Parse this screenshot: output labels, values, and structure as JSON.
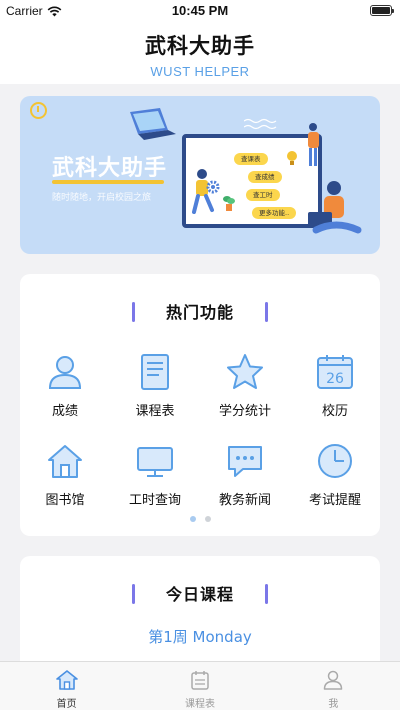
{
  "status": {
    "carrier": "Carrier",
    "time": "10:45 PM"
  },
  "header": {
    "title": "武科大助手",
    "subtitle": "WUST HELPER"
  },
  "banner": {
    "title": "武科大助手",
    "tagline": "随时随地，开启校园之旅",
    "tags": [
      "查课表",
      "查成绩",
      "查工时",
      "更多功能.."
    ]
  },
  "hot": {
    "title": "热门功能",
    "items": [
      {
        "label": "成绩",
        "icon": "person-icon"
      },
      {
        "label": "课程表",
        "icon": "document-icon"
      },
      {
        "label": "学分统计",
        "icon": "star-icon"
      },
      {
        "label": "校历",
        "icon": "calendar-icon",
        "badge": "26"
      },
      {
        "label": "图书馆",
        "icon": "house-icon"
      },
      {
        "label": "工时查询",
        "icon": "monitor-icon"
      },
      {
        "label": "教务新闻",
        "icon": "chat-bubble-icon"
      },
      {
        "label": "考试提醒",
        "icon": "clock-icon"
      }
    ],
    "page": 1,
    "pages": 2
  },
  "today": {
    "title": "今日课程",
    "week": "第1周 Monday"
  },
  "tabs": [
    {
      "label": "首页",
      "icon": "home-icon",
      "active": true
    },
    {
      "label": "课程表",
      "icon": "schedule-icon",
      "active": false
    },
    {
      "label": "我",
      "icon": "profile-icon",
      "active": false
    }
  ],
  "colors": {
    "accent": "#4a90e2",
    "section_bar": "#7b77e8",
    "banner_bg": "#c5dcf7",
    "highlight": "#f3c333"
  }
}
